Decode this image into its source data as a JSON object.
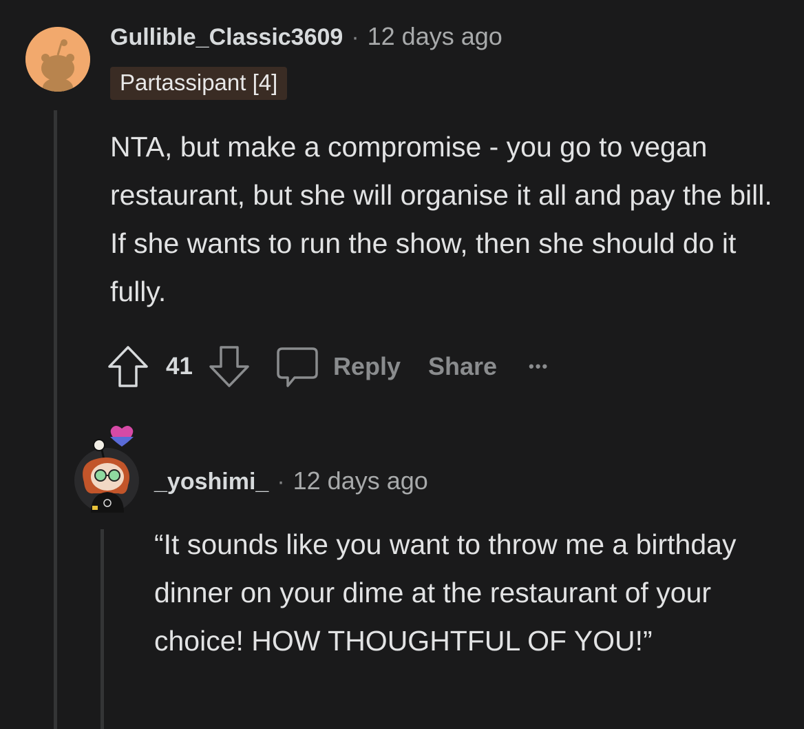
{
  "comments": [
    {
      "username": "Gullible_Classic3609",
      "separator": "·",
      "timestamp": "12 days ago",
      "flair": "Partassipant [4]",
      "body": "NTA, but make a compromise - you go to vegan restaurant, but she will organise it all and pay the bill. If she wants to run the show, then she should do it fully.",
      "score": "41",
      "actions": {
        "reply": "Reply",
        "share": "Share",
        "more": "•••"
      }
    },
    {
      "username": "_yoshimi_",
      "separator": "·",
      "timestamp": "12 days ago",
      "body": "“It sounds like you want to throw me a birthday dinner on your dime at the restaurant of your choice! HOW THOUGHTFUL OF YOU!”"
    }
  ],
  "icons": {
    "upvote": "arrow-up-outline",
    "downvote": "arrow-down-outline",
    "comment": "speech-bubble-outline",
    "more": "horizontal-ellipsis"
  },
  "colors": {
    "background": "#1a1a1b",
    "thread_line": "#343536",
    "flair_bg": "#3a2c24",
    "muted": "#8a8c8e"
  }
}
